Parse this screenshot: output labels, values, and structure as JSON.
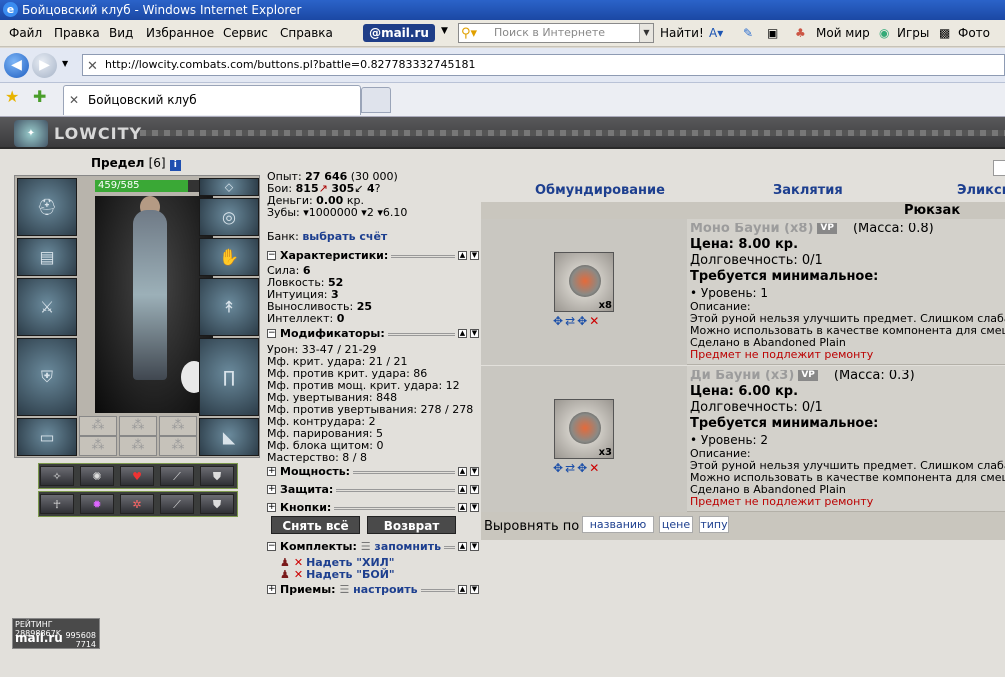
{
  "window": {
    "title": "Бойцовский клуб - Windows Internet Explorer"
  },
  "menu": {
    "items": [
      "Файл",
      "Правка",
      "Вид",
      "Избранное",
      "Сервис",
      "Справка"
    ],
    "mail_label": "@mail.ru",
    "search_placeholder": "Поиск в Интернете",
    "find_label": "Найти!",
    "my_world": "Мой мир",
    "games": "Игры",
    "photo": "Фото"
  },
  "address": {
    "url": "http://lowcity.combats.com/buttons.pl?battle=0.827783332745181"
  },
  "tabs": [
    {
      "label": "Бойцовский клуб"
    }
  ],
  "game": {
    "logo_text": "LOWCITY"
  },
  "player": {
    "name": "Предел",
    "level": "[6]",
    "hp": "459/585",
    "hp_fraction": 0.785
  },
  "stats": {
    "exp_label": "Опыт:",
    "exp_value": "27 646",
    "exp_next": "(30 000)",
    "fights_label": "Бои:",
    "wins": "815",
    "losses": "305",
    "draws": "4",
    "money_label": "Деньги:",
    "money_value": "0.00",
    "money_unit": "кр.",
    "teeth_label": "Зубы:",
    "teeth_a": "1000000",
    "teeth_b": "2",
    "teeth_c": "6.10",
    "bank_label": "Банк:",
    "bank_link": "выбрать счёт"
  },
  "characteristics": {
    "title": "Характеристики:",
    "rows": [
      {
        "label": "Сила:",
        "value": "6"
      },
      {
        "label": "Ловкость:",
        "value": "52"
      },
      {
        "label": "Интуиция:",
        "value": "3"
      },
      {
        "label": "Выносливость:",
        "value": "25"
      },
      {
        "label": "Интеллект:",
        "value": "0"
      }
    ]
  },
  "modifiers": {
    "title": "Модификаторы:",
    "rows": [
      "Урон: 33-47 / 21-29",
      "Мф. крит. удара: 21 / 21",
      "Мф. против крит. удара: 86",
      "Мф. против мощ. крит. удара: 12",
      "Мф. увертывания: 848",
      "Мф. против увертывания: 278 / 278",
      "Мф. контрудара: 2",
      "Мф. парирования: 5",
      "Мф. блока щитом: 0",
      "Мастерство: 8 / 8"
    ]
  },
  "sections": {
    "power": "Мощность:",
    "defense": "Защита:",
    "buttons": "Кнопки:",
    "sets": "Комплекты:",
    "sets_link": "запомнить",
    "skills": "Приемы:",
    "skills_link": "настроить"
  },
  "actions": {
    "remove_all": "Снять всё",
    "return": "Возврат"
  },
  "sets": [
    {
      "label": "Надеть \"ХИЛ\""
    },
    {
      "label": "Надеть \"БОЙ\""
    }
  ],
  "rating": {
    "label": "РЕЙТИНГ",
    "code": "28898867K",
    "n1": "995608",
    "n2": "7714",
    "brand": "mail.ru"
  },
  "inventory": {
    "tabs": [
      "Обмундирование",
      "Заклятия",
      "Эликси"
    ],
    "header": "Рюкзак (масс",
    "items": [
      {
        "name": "Моно Бауни (x8)",
        "vp": "VP",
        "mass": "(Масса: 0.8)",
        "count": "x8",
        "price": "Цена: 8.00 кр.",
        "durability": "Долговечность: 0/1",
        "req": "Требуется минимальное:",
        "level": "• Уровень: 1",
        "desc_label": "Описание:",
        "desc1": "Этой руной нельзя улучшить предмет. Слишком слабая",
        "desc2": "Можно использовать в качестве компонента для смеши",
        "made": "Сделано в Abandoned Plain",
        "norepair": "Предмет не подлежит ремонту"
      },
      {
        "name": "Ди Бауни (x3)",
        "vp": "VP",
        "mass": "(Масса: 0.3)",
        "count": "x3",
        "price": "Цена: 6.00 кр.",
        "durability": "Долговечность: 0/1",
        "req": "Требуется минимальное:",
        "level": "• Уровень: 2",
        "desc_label": "Описание:",
        "desc1": "Этой руной нельзя улучшить предмет. Слишком слабая",
        "desc2": "Можно использовать в качестве компонента для смеши",
        "made": "Сделано в Abandoned Plain",
        "norepair": "Предмет не подлежит ремонту"
      }
    ],
    "sort_label": "Выровнять по",
    "sort_options": [
      "названию",
      "цене",
      "типу"
    ]
  }
}
